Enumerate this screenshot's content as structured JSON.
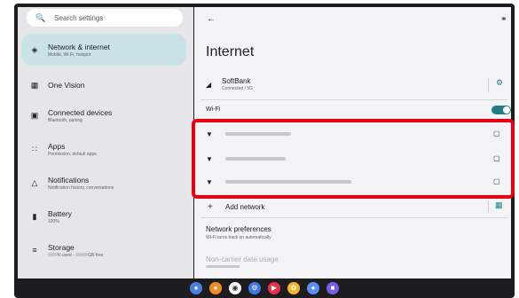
{
  "search": {
    "placeholder": "Search settings",
    "icon": "search-icon"
  },
  "sidebar": {
    "items": [
      {
        "title": "Network & internet",
        "subtitle": "Mobile, Wi-Fi, hotspot",
        "icon": "wifi-icon",
        "active": true
      },
      {
        "title": "One Vision",
        "subtitle": "",
        "icon": "grid-icon"
      },
      {
        "title": "Connected devices",
        "subtitle": "Bluetooth, pairing",
        "icon": "devices-icon"
      },
      {
        "title": "Apps",
        "subtitle": "Permission, default apps",
        "icon": "apps-icon"
      },
      {
        "title": "Notifications",
        "subtitle": "Notification history, conversations",
        "icon": "bell-icon"
      },
      {
        "title": "Battery",
        "subtitle": "100%",
        "icon": "battery-icon"
      },
      {
        "title": "Storage",
        "subtitle_used": "% used -",
        "subtitle_free": "GB free",
        "icon": "storage-icon"
      }
    ]
  },
  "main": {
    "title": "Internet",
    "carrier": {
      "name": "SoftBank",
      "status": "Connected / 5G"
    },
    "wifi_label": "Wi-Fi",
    "wifi_enabled": true,
    "add_network": "Add network",
    "preferences": {
      "title": "Network preferences",
      "subtitle": "Wi-Fi turns back on automatically"
    },
    "non_carrier": {
      "title": "Non-carrier data usage"
    }
  },
  "colors": {
    "accent": "#1f7d8a",
    "highlight": "#e60012",
    "active_bg": "#c9e3e6"
  },
  "dock": [
    "chrome-icon",
    "firefox-icon",
    "camera-icon",
    "settings-icon",
    "youtube-icon",
    "photos-icon",
    "assistant-icon",
    "games-icon"
  ]
}
